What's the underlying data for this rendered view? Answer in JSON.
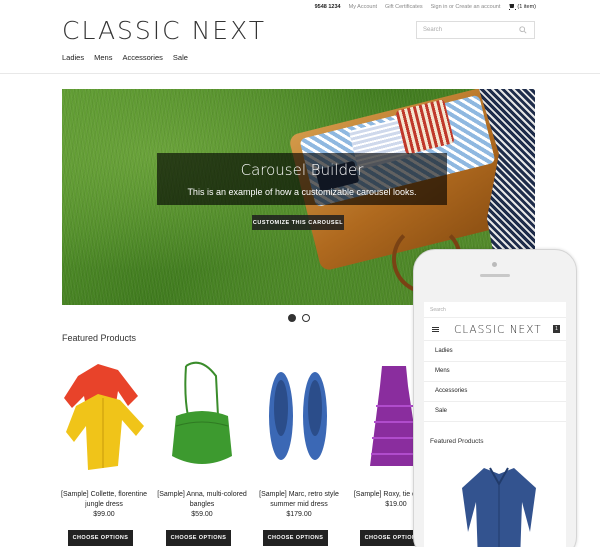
{
  "utility": {
    "phone": "9548 1234",
    "my_account": "My Account",
    "gift_certificates": "Gift Certificates",
    "sign_in": "Sign in or Create an account",
    "cart": "(1 item)"
  },
  "logo": "CLASSIC NEXT",
  "search": {
    "placeholder": "Search"
  },
  "nav": [
    "Ladies",
    "Mens",
    "Accessories",
    "Sale"
  ],
  "hero": {
    "title": "Carousel Builder",
    "subtitle": "This is an example of how a customizable carousel looks.",
    "button": "CUSTOMIZE THIS CAROUSEL",
    "slides": 2,
    "active_slide": 1
  },
  "featured_title": "Featured Products",
  "products": [
    {
      "name": "[Sample] Collette, florentine jungle dress",
      "price": "$99.00",
      "button": "CHOOSE OPTIONS"
    },
    {
      "name": "[Sample] Anna, multi-colored bangles",
      "price": "$59.00",
      "button": "CHOOSE OPTIONS"
    },
    {
      "name": "[Sample] Marc, retro style summer mid dress",
      "price": "$179.00",
      "button": "CHOOSE OPTIONS"
    },
    {
      "name": "[Sample] Roxy, tie dye mini",
      "price": "$19.00",
      "button": "CHOOSE OPTIONS"
    }
  ],
  "mobile": {
    "search_placeholder": "Search",
    "logo": "CLASSIC NEXT",
    "cart_count": "1",
    "nav": [
      "Ladies",
      "Mens",
      "Accessories",
      "Sale"
    ],
    "featured_title": "Featured Products"
  },
  "colors": {
    "text": "#333333",
    "button": "#222222",
    "divider": "#e8e8e8"
  }
}
